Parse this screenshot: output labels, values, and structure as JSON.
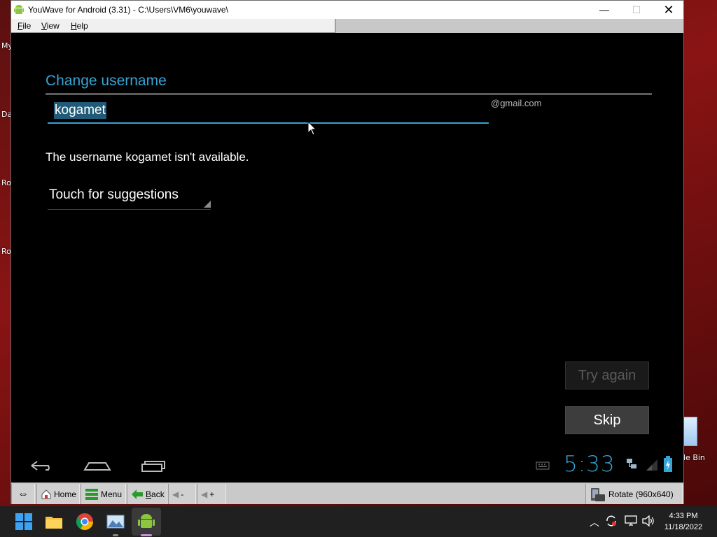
{
  "desktop": {
    "labels": [
      "My",
      "Da",
      "Ro",
      "Ro"
    ],
    "recycle_bin_label": "le Bin"
  },
  "window": {
    "title": "YouWave for Android (3.31) - C:\\Users\\VM6\\youwave\\",
    "minimize_glyph": "—",
    "maximize_glyph": "☐",
    "close_glyph": "✕",
    "menu": [
      {
        "underline": "F",
        "rest": "ile"
      },
      {
        "underline": "V",
        "rest": "iew"
      },
      {
        "underline": "H",
        "rest": "elp"
      }
    ]
  },
  "android": {
    "heading": "Change username",
    "username_value": "kogamet",
    "domain_suffix": "@gmail.com",
    "status_message": "The username kogamet isn't available.",
    "suggestions_label": "Touch for suggestions",
    "try_again_label": "Try again",
    "skip_label": "Skip",
    "clock": "5:33",
    "accent_color": "#35a4d6"
  },
  "toolbar": {
    "home_label": "Home",
    "menu_label": "Menu",
    "back_underline": "B",
    "back_rest": "ack",
    "vol_down_label": "-",
    "vol_up_label": "+",
    "rotate_label": "Rotate (960x640)"
  },
  "taskbar": {
    "time": "4:33 PM",
    "date": "11/18/2022",
    "apps": [
      "start-icon",
      "file-explorer-icon",
      "chrome-icon",
      "photos-icon",
      "android-icon"
    ]
  }
}
